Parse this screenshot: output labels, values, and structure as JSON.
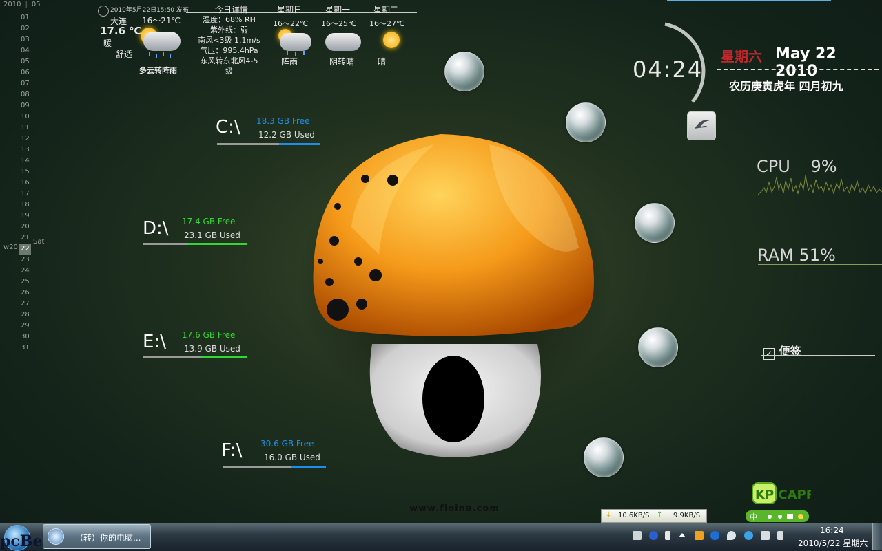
{
  "calendar": {
    "year": "2010",
    "month": "05",
    "days": [
      "01",
      "02",
      "03",
      "04",
      "05",
      "06",
      "07",
      "08",
      "09",
      "10",
      "11",
      "12",
      "13",
      "14",
      "15",
      "16",
      "17",
      "18",
      "19",
      "20",
      "21",
      "22",
      "23",
      "24",
      "25",
      "26",
      "27",
      "28",
      "29",
      "30",
      "31"
    ],
    "today_index": 21,
    "week_label": "w20",
    "weekday_label": "Sat"
  },
  "weather": {
    "published": "2010年5月22日15:50 发布",
    "city": "大连",
    "temp": "17.6 ℃",
    "feel": "暖",
    "comfort": "舒适",
    "today_range": "16～21℃",
    "today_desc": "多云转阵雨",
    "details_title": "今日详情",
    "details": [
      "湿度：68% RH",
      "紫外线：弱",
      "南风<3级 1.1m/s",
      "气压：995.4hPa",
      "东风转东北风4-5",
      "级"
    ],
    "forecast": [
      {
        "day": "星期日",
        "range": "16～22℃",
        "desc": "阵雨",
        "icon": "rain-cloud-icon"
      },
      {
        "day": "星期一",
        "range": "16～25℃",
        "desc": "阴转晴",
        "icon": "cloud-icon"
      },
      {
        "day": "星期二",
        "range": "16～27℃",
        "desc": "晴",
        "icon": "sun-icon"
      }
    ]
  },
  "drives": [
    {
      "letter": "C:\\",
      "free": "18.3 GB Free",
      "used": "12.2 GB Used",
      "used_fraction": 0.4,
      "color": "#1e8ee8"
    },
    {
      "letter": "D:\\",
      "free": "17.4 GB Free",
      "used": "23.1 GB Used",
      "used_fraction": 0.57,
      "color": "#33d633"
    },
    {
      "letter": "E:\\",
      "free": "17.6 GB Free",
      "used": "13.9 GB Used",
      "used_fraction": 0.44,
      "color": "#33d633"
    },
    {
      "letter": "F:\\",
      "free": "30.6 GB Free",
      "used": "16.0 GB Used",
      "used_fraction": 0.34,
      "color": "#1e8ee8"
    }
  ],
  "clock": {
    "time": "04:24",
    "weekday": "星期六",
    "date": "May 22 2010",
    "lunar": "农历庚寅虎年 四月初九"
  },
  "meters": {
    "cpu_label": "CPU",
    "cpu_value": "9%",
    "ram_label": "RAM",
    "ram_value": "51%"
  },
  "notes": {
    "label": "便签",
    "icon": "checkbox-icon"
  },
  "wallpaper": {
    "credit": "www.floina.com"
  },
  "network": {
    "down": "10.6KB/S",
    "up": "9.9KB/S"
  },
  "tray_logo": {
    "text": "KP CAPRICORN",
    "ime_label": "中"
  },
  "taskbar": {
    "watermark": "pcBeta",
    "task_title": "（转）你的电脑...",
    "time": "16:24",
    "date": "2010/5/22 星期六"
  }
}
